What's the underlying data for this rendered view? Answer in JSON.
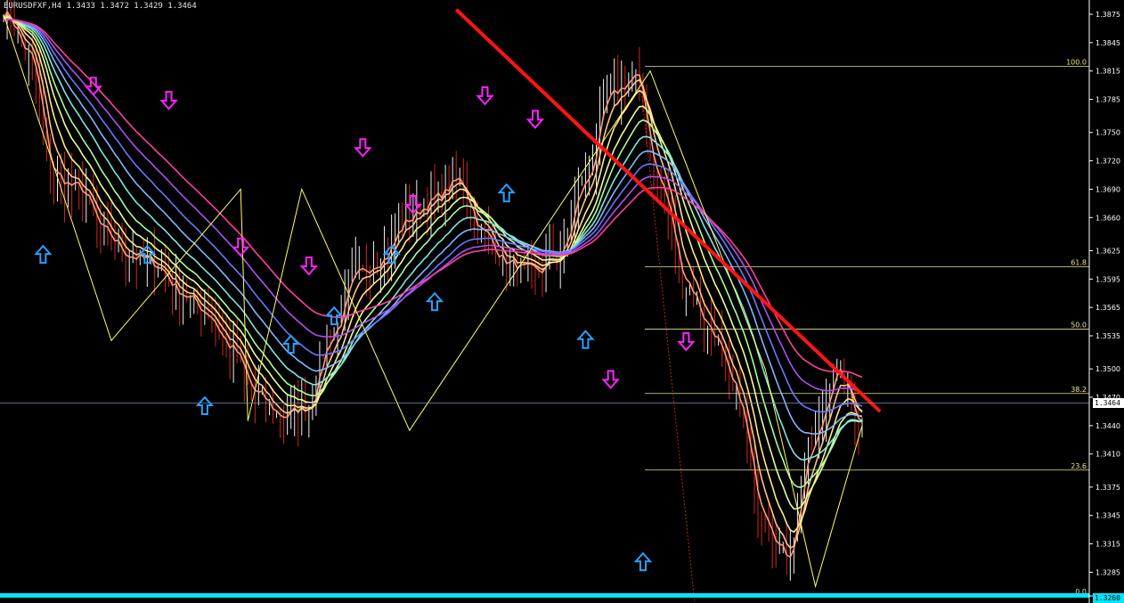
{
  "header": {
    "symbol_info": "EURUSDFXF,H4  1.3433 1.3472 1.3429 1.3464"
  },
  "colors": {
    "background": "#000000",
    "axis_text": "#ffffff",
    "fib": "#e6e68c",
    "trendline": "#ff1414",
    "zigzag": "#ffff66",
    "up_arrow": "#2aa0ff",
    "down_arrow": "#ff22ff",
    "bid_line": "#7a8ab0",
    "low_line": "#00e5ff"
  },
  "chart_data": {
    "type": "line",
    "title": "",
    "xlabel": "",
    "ylabel": "",
    "ylim": [
      1.3255,
      1.3875
    ],
    "grid": false,
    "y_ticks": [
      "1.3875",
      "1.3845",
      "1.3815",
      "1.3785",
      "1.3750",
      "1.3720",
      "1.3690",
      "1.3660",
      "1.3625",
      "1.3595",
      "1.3565",
      "1.3535",
      "1.3500",
      "1.3470",
      "1.3440",
      "1.3410",
      "1.3375",
      "1.3345",
      "1.3315",
      "1.3285",
      "1.3260"
    ],
    "y_tick_values": [
      1.3875,
      1.3845,
      1.3815,
      1.3785,
      1.375,
      1.372,
      1.369,
      1.366,
      1.3625,
      1.3595,
      1.3565,
      1.3535,
      1.35,
      1.347,
      1.344,
      1.341,
      1.3375,
      1.3345,
      1.3315,
      1.3285,
      1.326
    ],
    "current_price": {
      "label": "1.3464",
      "value": 1.3464
    },
    "low_price": {
      "label": "1.3260",
      "value": 1.326
    },
    "fib_levels": [
      {
        "label": "100.0",
        "value": 1.382
      },
      {
        "label": "61.8",
        "value": 1.3608
      },
      {
        "label": "50.0",
        "value": 1.3542
      },
      {
        "label": "38.2",
        "value": 1.3474
      },
      {
        "label": "23.6",
        "value": 1.3393
      },
      {
        "label": "0.0",
        "value": 1.326
      }
    ],
    "bar_count": 240,
    "guide_prices": [
      1.388,
      1.383,
      1.37,
      1.369,
      1.364,
      1.362,
      1.361,
      1.358,
      1.356,
      1.352,
      1.347,
      1.345,
      1.346,
      1.354,
      1.36,
      1.362,
      1.366,
      1.368,
      1.37,
      1.364,
      1.361,
      1.36,
      1.362,
      1.37,
      1.379,
      1.381,
      1.369,
      1.359,
      1.354,
      1.347,
      1.335,
      1.33,
      1.342,
      1.35,
      1.344
    ],
    "ma_periods": [
      3,
      6,
      10,
      15,
      20,
      27,
      35,
      44,
      55,
      68
    ],
    "ma_colors": [
      "#ff9a7a",
      "#ffc38a",
      "#ffea8c",
      "#e8ff9c",
      "#a8ff9c",
      "#80e8e0",
      "#80b8ff",
      "#6878ff",
      "#b050f0",
      "#ff40a0",
      "#ff2b3a"
    ],
    "zigzag": [
      {
        "bar": 0,
        "price": 1.3875
      },
      {
        "bar": 30,
        "price": 1.353
      },
      {
        "bar": 66,
        "price": 1.369
      },
      {
        "bar": 68,
        "price": 1.3445
      },
      {
        "bar": 83,
        "price": 1.369
      },
      {
        "bar": 113,
        "price": 1.3435
      },
      {
        "bar": 180,
        "price": 1.3815
      },
      {
        "bar": 212,
        "price": 1.35
      },
      {
        "bar": 226,
        "price": 1.327
      },
      {
        "bar": 239,
        "price": 1.344
      }
    ],
    "trendline": [
      {
        "bar": 126,
        "price": 1.388
      },
      {
        "bar": 244,
        "price": 1.3455
      }
    ],
    "up_arrows": [
      {
        "bar": 11,
        "price": 1.363
      },
      {
        "bar": 40,
        "price": 1.363
      },
      {
        "bar": 56,
        "price": 1.347
      },
      {
        "bar": 80,
        "price": 1.3535
      },
      {
        "bar": 92,
        "price": 1.3565
      },
      {
        "bar": 108,
        "price": 1.363
      },
      {
        "bar": 120,
        "price": 1.358
      },
      {
        "bar": 140,
        "price": 1.3695
      },
      {
        "bar": 162,
        "price": 1.354
      },
      {
        "bar": 178,
        "price": 1.3305
      }
    ],
    "down_arrows": [
      {
        "bar": 25,
        "price": 1.379
      },
      {
        "bar": 46,
        "price": 1.3775
      },
      {
        "bar": 66,
        "price": 1.362
      },
      {
        "bar": 85,
        "price": 1.36
      },
      {
        "bar": 100,
        "price": 1.3725
      },
      {
        "bar": 114,
        "price": 1.3665
      },
      {
        "bar": 134,
        "price": 1.378
      },
      {
        "bar": 148,
        "price": 1.3755
      },
      {
        "bar": 169,
        "price": 1.348
      },
      {
        "bar": 190,
        "price": 1.352
      }
    ]
  }
}
